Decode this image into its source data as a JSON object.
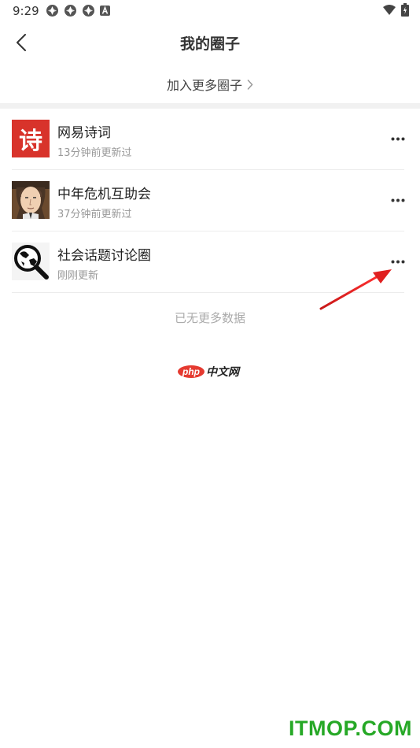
{
  "status_bar": {
    "time": "9:29",
    "left_icons": [
      "aperture-icon",
      "aperture-icon",
      "aperture-icon",
      "a-badge-icon"
    ],
    "right_icons": [
      "wifi-icon",
      "battery-icon"
    ]
  },
  "header": {
    "title": "我的圈子",
    "back_icon": "chevron-left-icon"
  },
  "join_more": {
    "label": "加入更多圈子",
    "icon": "chevron-right-icon"
  },
  "circles": [
    {
      "name": "网易诗词",
      "updated": "13分钟前更新过",
      "avatar_char": "诗",
      "avatar": "poem-seal"
    },
    {
      "name": "中年危机互助会",
      "updated": "37分钟前更新过",
      "avatar": "bald-man-face"
    },
    {
      "name": "社会话题讨论圈",
      "updated": "刚刚更新",
      "avatar": "globe-magnifier"
    }
  ],
  "no_more_text": "已无更多数据",
  "logo": {
    "badge": "php",
    "text": "中文网"
  },
  "watermark": "ITMOP.COM",
  "colors": {
    "accent_red": "#d8332b",
    "divider": "#f1f1f1",
    "annotation_red": "#e02020",
    "watermark_green": "#26a826"
  }
}
